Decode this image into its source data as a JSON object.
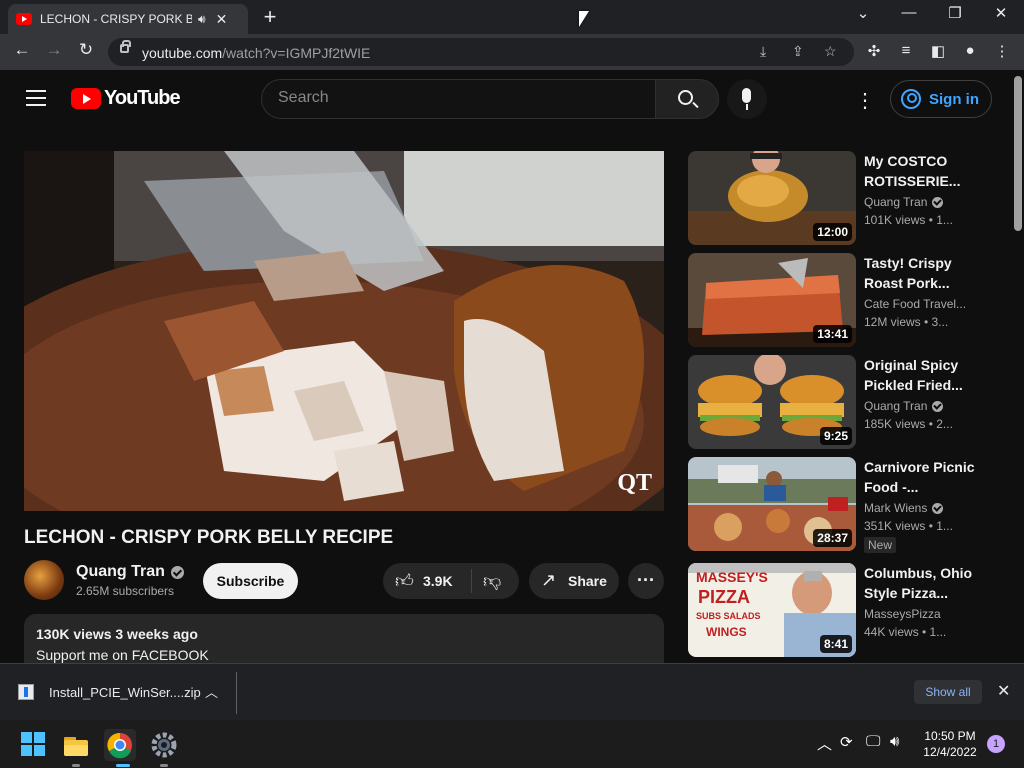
{
  "browser": {
    "tab_title": "LECHON - CRISPY PORK BELLY RECIPE - YouTube",
    "new_tab": "+",
    "url_host": "youtube.com",
    "url_path": "/watch?v=IGMPJf2tWIE"
  },
  "youtube": {
    "logo_text": "YouTube",
    "search_placeholder": "Search",
    "signin_label": "Sign in"
  },
  "video": {
    "title": "LECHON - CRISPY PORK BELLY RECIPE",
    "watermark": "QT",
    "channel": "Quang Tran",
    "subscribers": "2.65M subscribers",
    "subscribe_label": "Subscribe",
    "likes": "3.9K",
    "share_label": "Share",
    "views_date": "130K views  3 weeks ago",
    "description_line": "Support me on FACEBOOK"
  },
  "recommendations": [
    {
      "title": "My COSTCO ROTISSERIE...",
      "channel": "Quang Tran",
      "verified": true,
      "meta": "101K views  • 1...",
      "duration": "12:00",
      "badge": ""
    },
    {
      "title": "Tasty!  Crispy Roast Pork...",
      "channel": "Cate Food Travel...",
      "verified": false,
      "meta": "12M views  • 3...",
      "duration": "13:41",
      "badge": ""
    },
    {
      "title": "Original Spicy Pickled Fried...",
      "channel": "Quang Tran",
      "verified": true,
      "meta": "185K views  • 2...",
      "duration": "9:25",
      "badge": ""
    },
    {
      "title": "Carnivore Picnic Food -...",
      "channel": "Mark Wiens",
      "verified": true,
      "meta": "351K views  • 1...",
      "duration": "28:37",
      "badge": "New"
    },
    {
      "title": "Columbus, Ohio Style Pizza...",
      "channel": "MasseysPizza",
      "verified": false,
      "meta": "44K views  • 1...",
      "duration": "8:41",
      "badge": ""
    }
  ],
  "thumb_text": {
    "pizza_sign": "MASSEY'S",
    "pizza_word": "PIZZA",
    "pizza_sub": "SUBS SALADS",
    "pizza_wings": "WINGS"
  },
  "download": {
    "filename": "Install_PCIE_WinSer....zip",
    "show_all": "Show all"
  },
  "taskbar": {
    "time": "10:50 PM",
    "date": "12/4/2022",
    "notifications": "1"
  }
}
